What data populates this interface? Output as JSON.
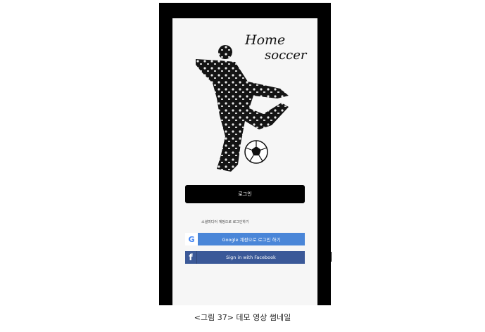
{
  "app": {
    "logo_line1": "Home",
    "logo_line2": "soccer"
  },
  "login": {
    "button_label": "로그인",
    "hint_text": "소셜미디어 계정으로 로그인하기",
    "google_label": "Google 계정으로 로그인 하기",
    "facebook_label": "Sign in with Facebook",
    "google_icon_glyph": "G",
    "facebook_icon_glyph": "f"
  },
  "caption": "<그림 37> 데모 영상 썸네일",
  "colors": {
    "google_blue": "#4a86d8",
    "facebook_blue": "#3b5998",
    "login_black": "#000000"
  },
  "icons": [
    "soccer-player-illustration",
    "soccer-ball-icon",
    "google-icon",
    "facebook-icon"
  ]
}
